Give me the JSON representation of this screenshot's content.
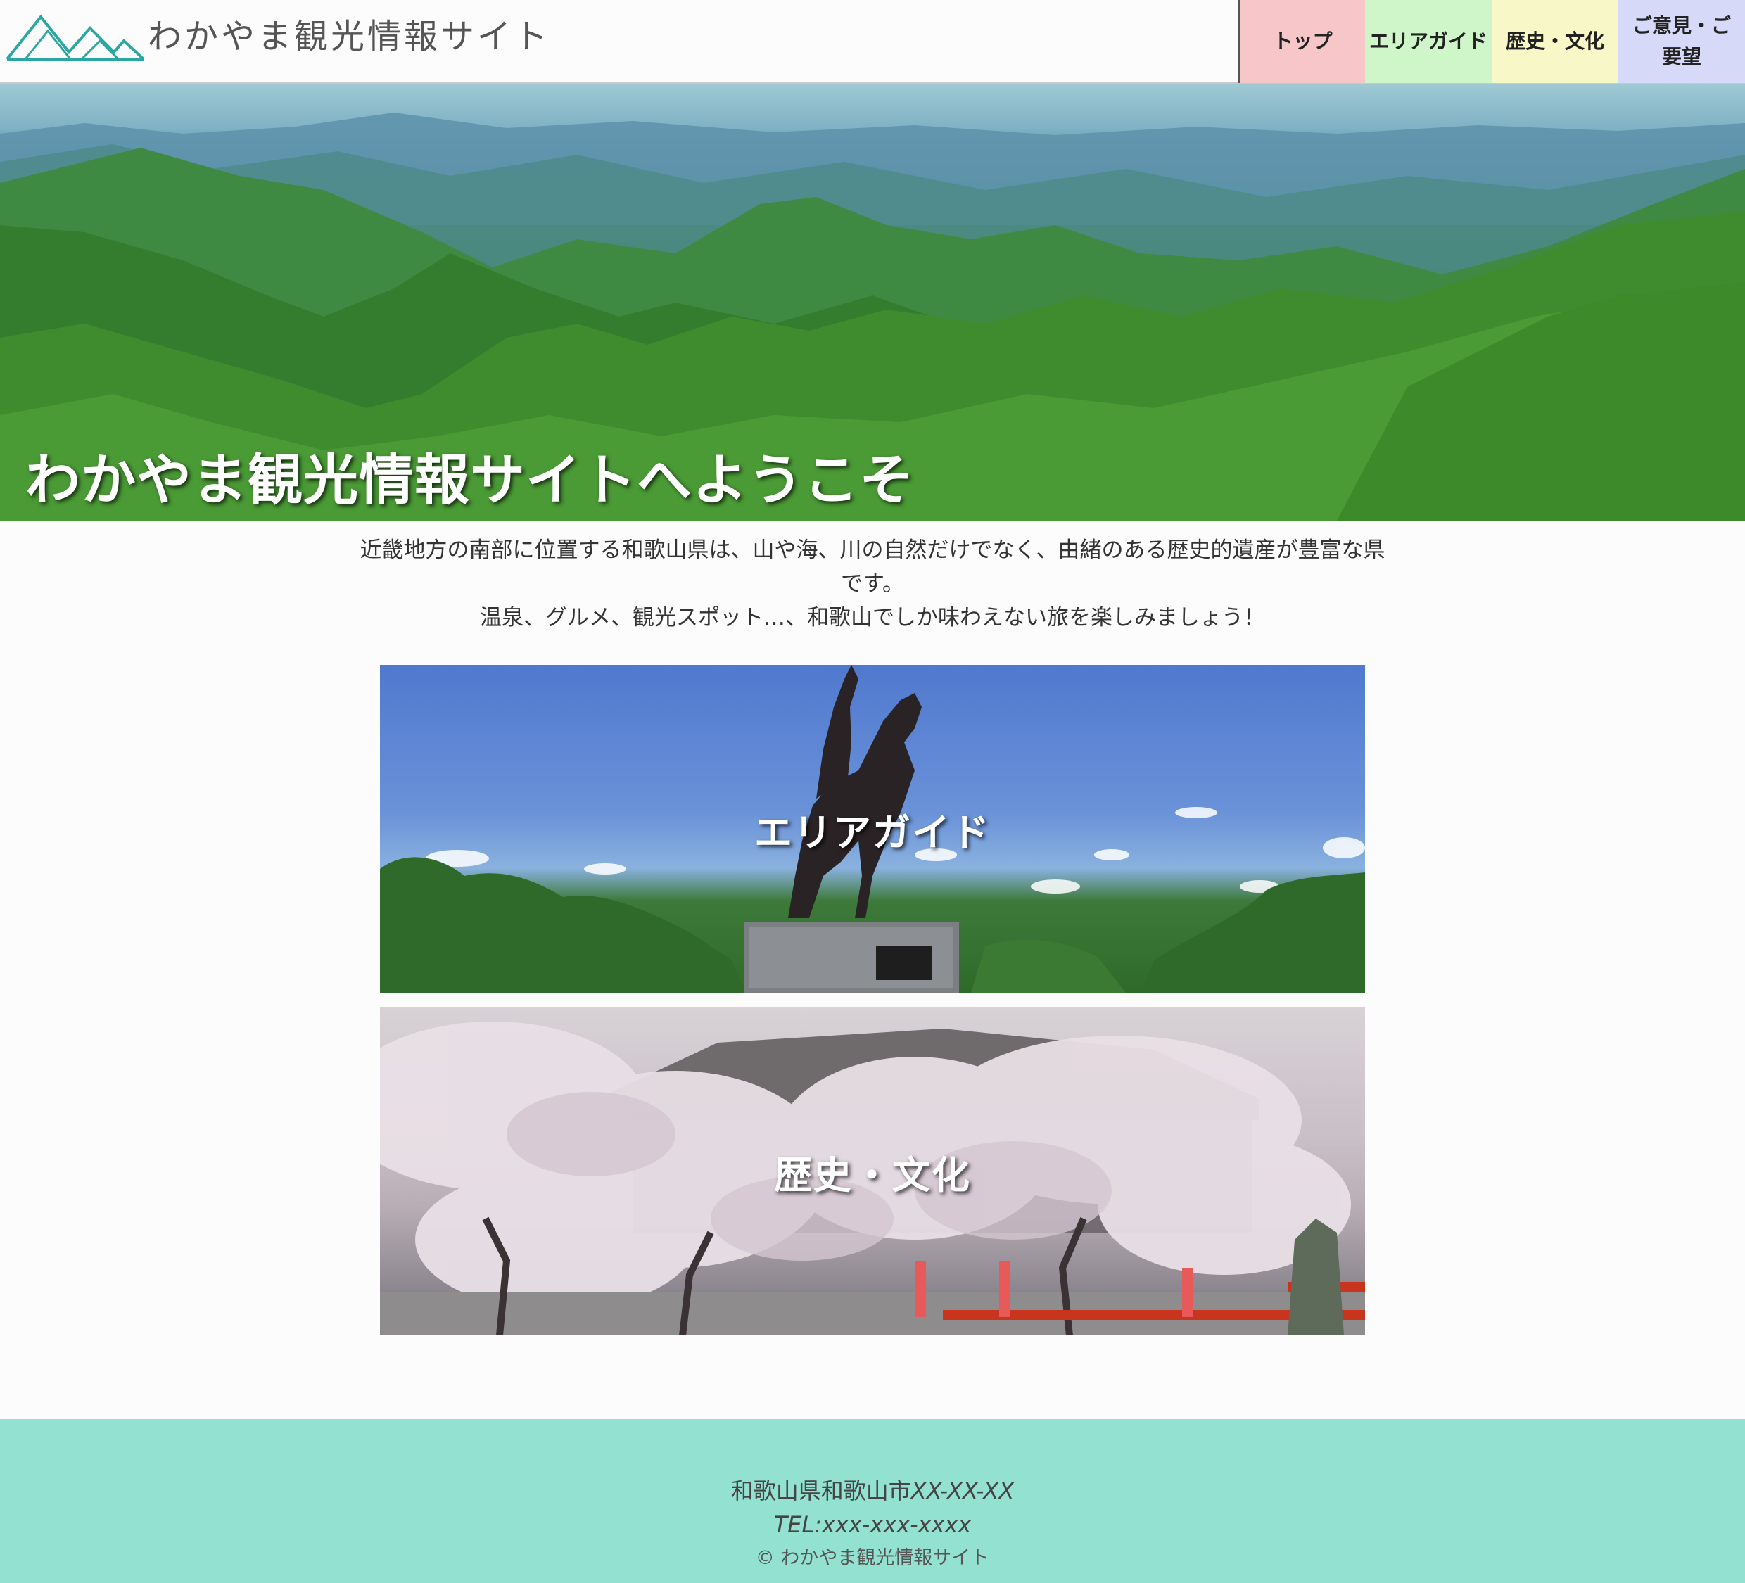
{
  "header": {
    "site_title": "わかやま観光情報サイト",
    "logo_icon": "mountain-logo-icon",
    "nav": [
      {
        "label": "トップ",
        "color": "#f6c6c9"
      },
      {
        "label": "エリアガイド",
        "color": "#cef6c8"
      },
      {
        "label": "歴史・文化",
        "color": "#f7f7c8"
      },
      {
        "label": "ご意見・ご要望",
        "color": "#d6d9f7"
      }
    ]
  },
  "hero": {
    "title": "わかやま観光情報サイトへようこそ"
  },
  "intro": {
    "line1": "近畿地方の南部に位置する和歌山県は、山や海、川の自然だけでなく、由緒のある歴史的遺産が豊富な県です。",
    "line2": "温泉、グルメ、観光スポット…、和歌山でしか味わえない旅を楽しみましょう！"
  },
  "cards": [
    {
      "label": "エリアガイド"
    },
    {
      "label": "歴史・文化"
    }
  ],
  "footer": {
    "address_prefix": "和歌山県和歌山市",
    "address_code": "XX-XX-XX",
    "tel": "TEL:xxx-xxx-xxxx",
    "copyright": "© わかやま観光情報サイト",
    "background": "#93e1d0"
  }
}
